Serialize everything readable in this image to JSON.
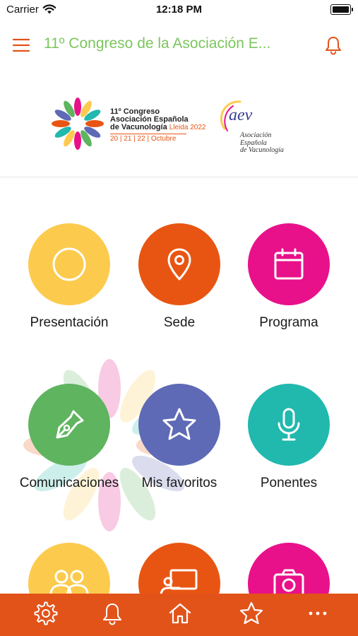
{
  "status_bar": {
    "carrier": "Carrier",
    "time": "12:18 PM"
  },
  "header": {
    "title": "11º Congreso de la Asociación E..."
  },
  "banner": {
    "congress_logo": {
      "line1": "11º Congreso",
      "line2": "Asociación Española",
      "line3": "de Vacunología",
      "city": "Lleida 2022",
      "dates": "20 | 21 | 22 | Octubre"
    },
    "aev_logo": {
      "mark": "aev",
      "line1": "Asociación",
      "line2": "Española",
      "line3": "de Vacunología"
    }
  },
  "colors": {
    "accent": "#e2531a",
    "title_green": "#7cc55e",
    "yellow": "#fccb4e",
    "orange": "#e85512",
    "magenta": "#e8118a",
    "green": "#5fb45f",
    "indigo": "#5e6ab5",
    "teal": "#21b8ae"
  },
  "menu": [
    {
      "label": "Presentación",
      "icon": "circle-icon",
      "color": "#fccb4e"
    },
    {
      "label": "Sede",
      "icon": "map-pin-icon",
      "color": "#e85512"
    },
    {
      "label": "Programa",
      "icon": "calendar-icon",
      "color": "#e8118a"
    },
    {
      "label": "Comunicaciones",
      "icon": "pen-nib-icon",
      "color": "#5fb45f"
    },
    {
      "label": "Mis favoritos",
      "icon": "star-icon",
      "color": "#5e6ab5"
    },
    {
      "label": "Ponentes",
      "icon": "microphone-icon",
      "color": "#21b8ae"
    },
    {
      "label": "",
      "icon": "users-icon",
      "color": "#fccb4e"
    },
    {
      "label": "",
      "icon": "presentation-icon",
      "color": "#e85512"
    },
    {
      "label": "",
      "icon": "camera-icon",
      "color": "#e8118a"
    }
  ],
  "tab_bar": [
    {
      "icon": "gear-icon"
    },
    {
      "icon": "bell-icon"
    },
    {
      "icon": "home-icon"
    },
    {
      "icon": "star-icon"
    },
    {
      "icon": "more-icon"
    }
  ]
}
